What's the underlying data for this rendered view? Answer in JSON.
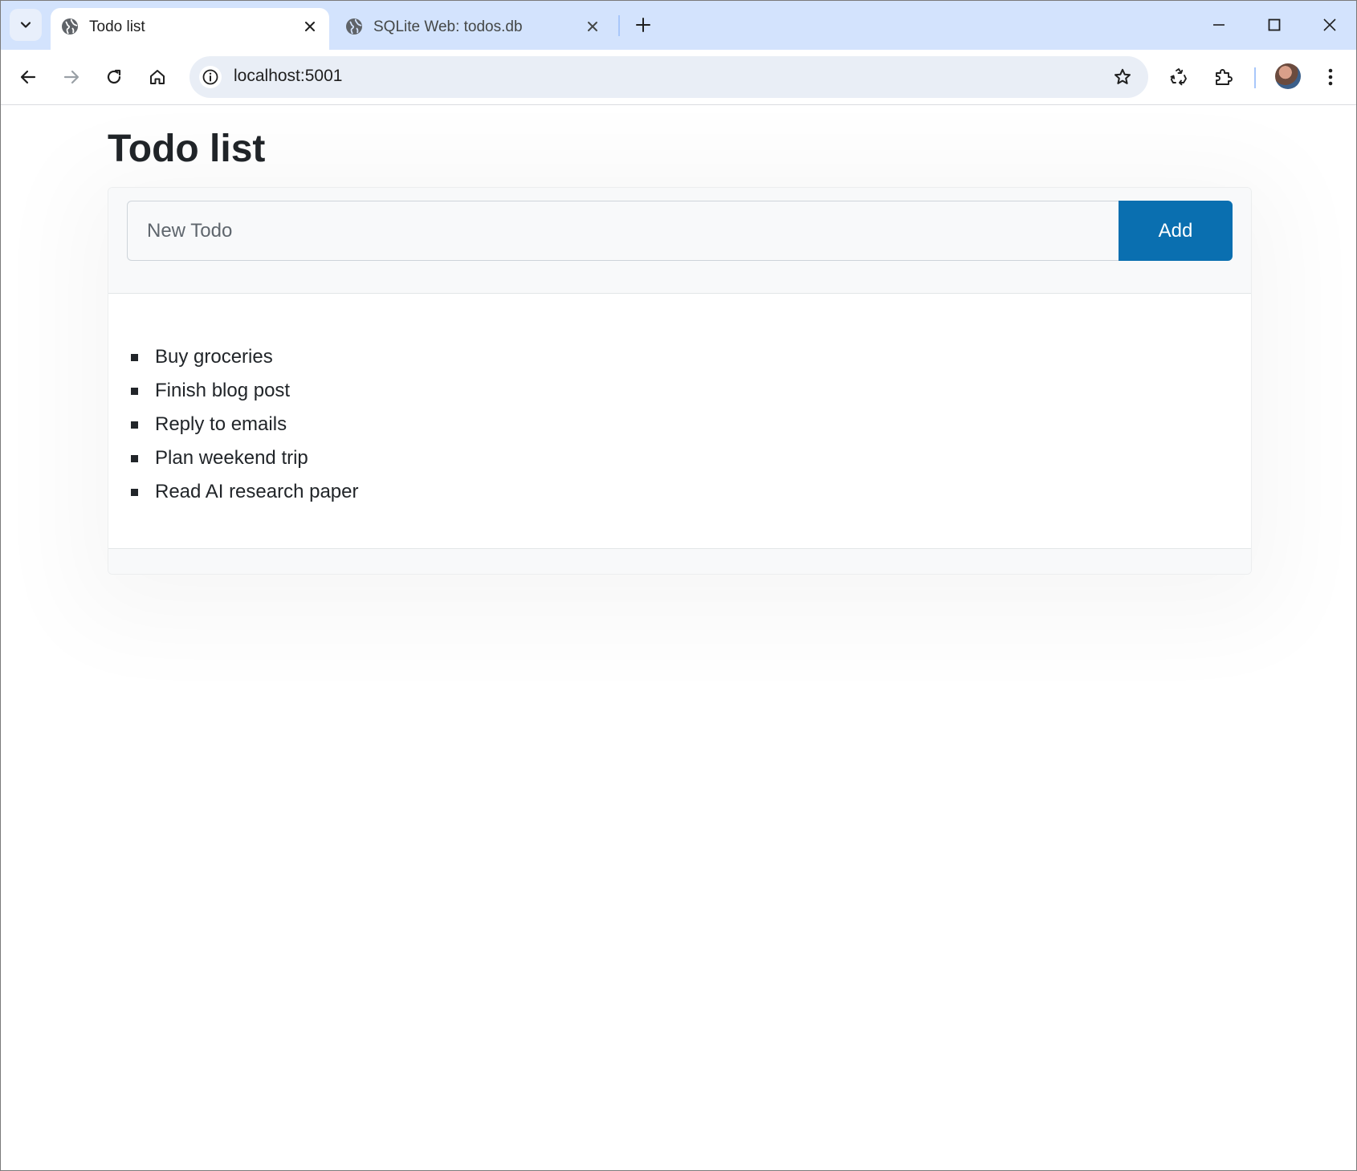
{
  "browser": {
    "tabs": [
      {
        "title": "Todo list",
        "active": true
      },
      {
        "title": "SQLite Web: todos.db",
        "active": false
      }
    ],
    "address_bar": {
      "url": "localhost:5001"
    }
  },
  "page": {
    "title": "Todo list",
    "new_todo": {
      "placeholder": "New Todo",
      "value": ""
    },
    "add_button_label": "Add",
    "todos": [
      "Buy groceries",
      "Finish blog post",
      "Reply to emails",
      "Plan weekend trip",
      "Read AI research paper"
    ]
  },
  "colors": {
    "tab_strip": "#d3e3fd",
    "omnibox": "#e9eef6",
    "add_button": "#0a6fb0",
    "heading_text": "#212529"
  }
}
